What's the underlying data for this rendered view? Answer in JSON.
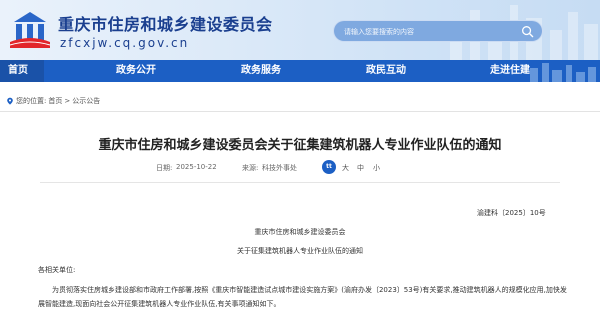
{
  "header": {
    "site_title": "重庆市住房和城乡建设委员会",
    "site_domain": "zfcxjw.cq.gov.cn",
    "search_placeholder": "请输入您要搜索的内容"
  },
  "nav": {
    "items": [
      "首页",
      "政务公开",
      "政务服务",
      "政民互动",
      "走进住建"
    ],
    "active_index": 0
  },
  "breadcrumb": {
    "prefix": "您的位置:",
    "home": "首页",
    "sep": ">",
    "current": "公示公告"
  },
  "article": {
    "title": "重庆市住房和城乡建设委员会关于征集建筑机器人专业作业队伍的通知",
    "date_label": "日期:",
    "date": "2025-10-22",
    "source_label": "来源:",
    "source": "科技外事处",
    "share_icon": "tt",
    "font_sizes": [
      "大",
      "中",
      "小"
    ],
    "doc_number": "渝建科〔2025〕10号",
    "issuer_line": "重庆市住房和城乡建设委员会",
    "notice_line": "关于征集建筑机器人专业作业队伍的通知",
    "salutation": "各相关单位:",
    "paragraph_1": "为贯彻落实住房城乡建设部和市政府工作部署,按照《重庆市智能建造试点城市建设实施方案》(渝府办发〔2023〕53号)有关要求,推动建筑机器人的规模化应用,加快发展智能建造,现面向社会公开征集建筑机器人专业作业队伍,有关事项通知如下。"
  },
  "colors": {
    "brand_blue": "#1c5fc4",
    "title_blue": "#1a3f8f"
  }
}
